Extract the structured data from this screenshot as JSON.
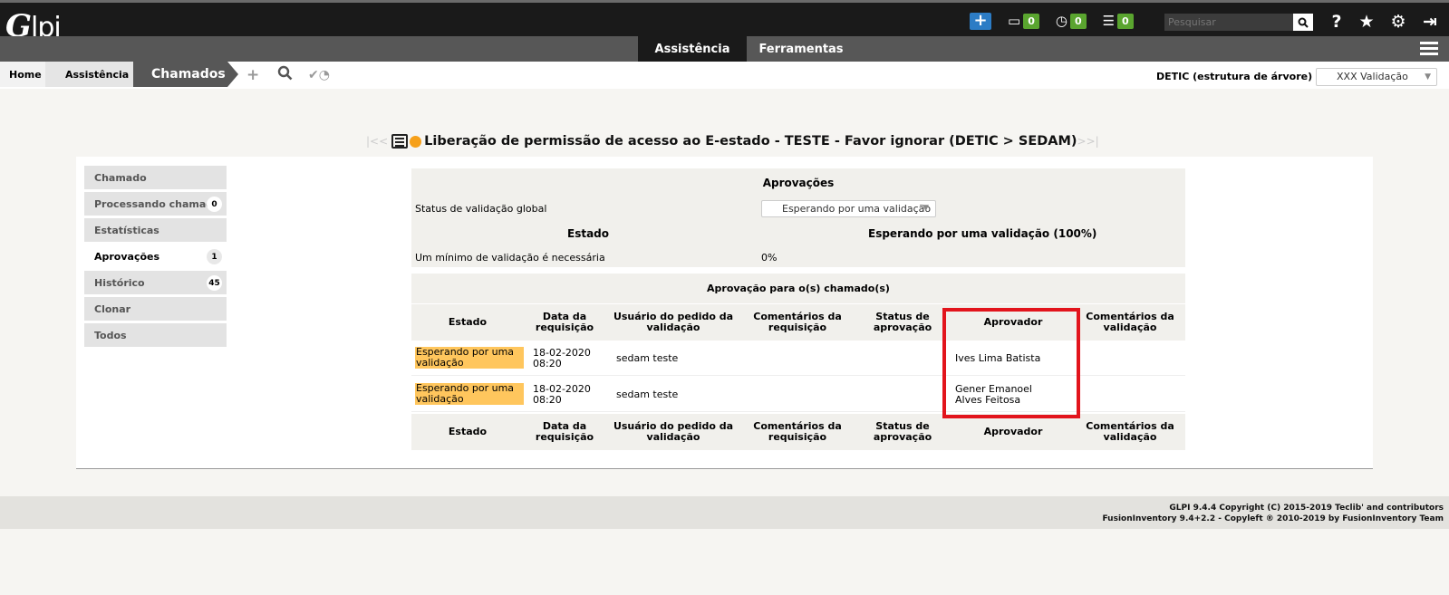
{
  "header": {
    "logo": "Glpi",
    "counters": [
      {
        "icon": "ticket-icon",
        "count": "0"
      },
      {
        "icon": "clock-icon",
        "count": "0"
      },
      {
        "icon": "tasks-icon",
        "count": "0"
      }
    ],
    "search_placeholder": "Pesquisar"
  },
  "menu": {
    "items": [
      {
        "label": "Assistência",
        "active": true
      },
      {
        "label": "Ferramentas",
        "active": false
      }
    ]
  },
  "breadcrumb": {
    "items": [
      "Home",
      "Assistência",
      "Chamados"
    ]
  },
  "entity": {
    "label": "DETIC (estrutura de árvore)",
    "selected": "XXX Validação"
  },
  "title": {
    "prev": "|<<",
    "next": ">>|",
    "text": "Liberação de permissão de acesso ao E-estado - TESTE - Favor ignorar (DETIC > SEDAM)"
  },
  "tabs": [
    {
      "label": "Chamado",
      "badge": ""
    },
    {
      "label": "Processando chamado",
      "badge": "0"
    },
    {
      "label": "Estatísticas",
      "badge": ""
    },
    {
      "label": "Aprovações",
      "badge": "1"
    },
    {
      "label": "Histórico",
      "badge": "45"
    },
    {
      "label": "Clonar",
      "badge": ""
    },
    {
      "label": "Todos",
      "badge": ""
    }
  ],
  "approvals": {
    "heading": "Aprovações",
    "global_status_label": "Status de validação global",
    "global_status_value": "Esperando por uma validação",
    "state_label": "Estado",
    "state_value": "Esperando por uma validação (100%)",
    "min_validation_label": "Um mínimo de validação é necessária",
    "min_validation_value": "0%"
  },
  "table": {
    "caption": "Aprovação para o(s) chamado(s)",
    "columns": [
      "Estado",
      "Data da requisição",
      "Usuário do pedido da validação",
      "Comentários da requisição",
      "Status de aprovação",
      "Aprovador",
      "Comentários da validação"
    ],
    "rows": [
      {
        "estado": "Esperando por uma validação",
        "data": "18-02-2020 08:20",
        "usuario": "sedam teste",
        "comentarios_req": "",
        "status": "",
        "aprovador": "Ives Lima Batista",
        "comentarios_val": ""
      },
      {
        "estado": "Esperando por uma validação",
        "data": "18-02-2020 08:20",
        "usuario": "sedam teste",
        "comentarios_req": "",
        "status": "",
        "aprovador": "Gener Emanoel Alves Feitosa",
        "comentarios_val": ""
      }
    ]
  },
  "footer": {
    "line1": "GLPI 9.4.4 Copyright (C) 2015-2019 Teclib' and contributors",
    "line2": "FusionInventory 9.4+2.2 - Copyleft ® 2010-2019 by FusionInventory Team"
  },
  "colors": {
    "pending_status": "#ffc65d",
    "highlight_box": "#e2141c",
    "counter_badge": "#5aa52f",
    "add_button": "#2c7cc5"
  }
}
